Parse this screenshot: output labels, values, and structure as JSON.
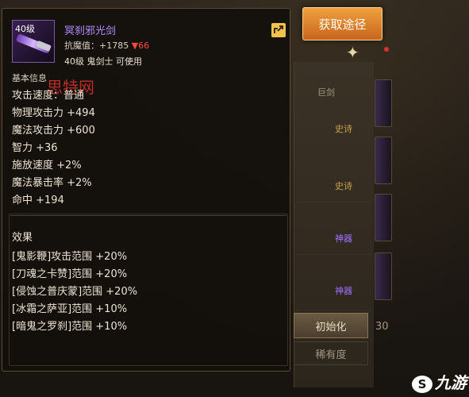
{
  "obtain_button": "获取途径",
  "item": {
    "level_badge": "40级",
    "name": "冥刹邪光剑",
    "resist_label": "抗魔值：+1785",
    "resist_change": "▼66",
    "requirement": "40级 鬼剑士 可使用"
  },
  "section_title": "基本信息",
  "stats": [
    "攻击速度：普通",
    "物理攻击力 +494",
    "魔法攻击力 +600",
    "智力 +36",
    "施放速度 +2%",
    "魔法暴击率 +2%",
    "命中 +194"
  ],
  "effects_title": "效果",
  "effects": [
    "[鬼影鞭]攻击范围 +20%",
    "[刀魂之卡赞]范围 +20%",
    "[侵蚀之普庆蒙]范围 +20%",
    "[冰霜之萨亚]范围 +10%",
    "[暗鬼之罗刹]范围 +10%"
  ],
  "watermark": "思特网",
  "background": {
    "tags": [
      "巨剑",
      "史诗",
      "史诗",
      "神器",
      "神器"
    ],
    "button_refine": "初始化",
    "button_rarity": "稀有度",
    "page_num": "30"
  },
  "logo": {
    "mark": "S",
    "text": "九游"
  },
  "colors": {
    "epic": "#b58cff",
    "orange_button": "#e08a30",
    "resist_down": "#ff4a3a"
  }
}
